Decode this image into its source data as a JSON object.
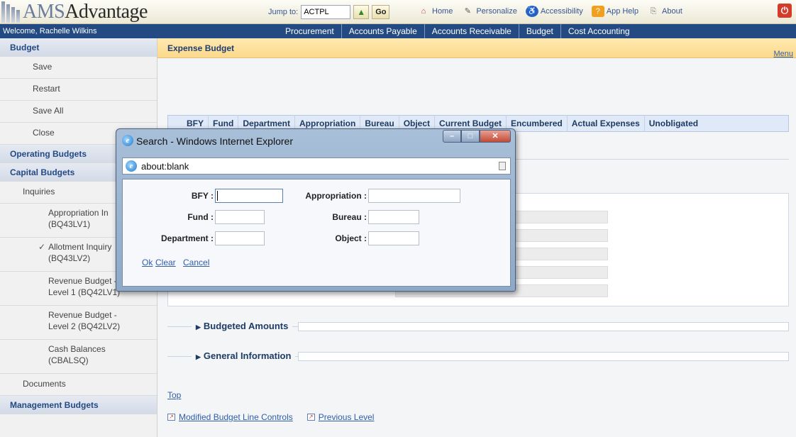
{
  "app": {
    "logo_prefix": "AMS",
    "logo_suffix": "Advantage"
  },
  "header": {
    "jump_label": "Jump to:",
    "jump_value": "ACTPL",
    "go_label": "Go",
    "links": [
      {
        "label": "Home",
        "icon": "home-icon"
      },
      {
        "label": "Personalize",
        "icon": "wrench-icon"
      },
      {
        "label": "Accessibility",
        "icon": "accessibility-icon"
      },
      {
        "label": "App Help",
        "icon": "help-icon"
      },
      {
        "label": "About",
        "icon": "about-icon"
      }
    ]
  },
  "nav": {
    "welcome": "Welcome, Rachelle Wilkins",
    "menus": [
      "Procurement",
      "Accounts Payable",
      "Accounts Receivable",
      "Budget",
      "Cost Accounting"
    ]
  },
  "sidebar": {
    "budget_head": "Budget",
    "actions": [
      "Save",
      "Restart",
      "Save All",
      "Close"
    ],
    "operating": "Operating Budgets",
    "capital": "Capital Budgets",
    "inquiries": "Inquiries",
    "subitems": [
      {
        "line1": "Appropriation In",
        "line2": "(BQ43LV1)"
      },
      {
        "line1": "Allotment Inquiry",
        "line2": "(BQ43LV2)"
      },
      {
        "line1": "Revenue Budget -",
        "line2": "Level 1 (BQ42LV1)"
      },
      {
        "line1": "Revenue Budget -",
        "line2": "Level 2 (BQ42LV2)"
      },
      {
        "line1": "Cash Balances",
        "line2": "(CBALSQ)"
      }
    ],
    "documents": "Documents",
    "management": "Management Budgets"
  },
  "main": {
    "title": "Expense Budget",
    "menu_link": "Menu",
    "columns": [
      "BFY",
      "Fund",
      "Department",
      "Appropriation",
      "Bureau",
      "Object",
      "Current Budget",
      "Encumbered",
      "Actual Expenses",
      "Unobligated"
    ],
    "sections": [
      "Budgeted Amounts",
      "General Information"
    ],
    "top_link": "Top",
    "bottom_links": [
      "Modified Budget Line Controls",
      "Previous Level"
    ]
  },
  "popup": {
    "title": "Search - Windows Internet Explorer",
    "address": "about:blank",
    "fields": {
      "bfy": "BFY :",
      "fund": "Fund :",
      "department": "Department :",
      "appropriation": "Appropriation :",
      "bureau": "Bureau :",
      "object": "Object :"
    },
    "actions": {
      "ok": "Ok",
      "clear": "Clear",
      "cancel": "Cancel"
    }
  }
}
